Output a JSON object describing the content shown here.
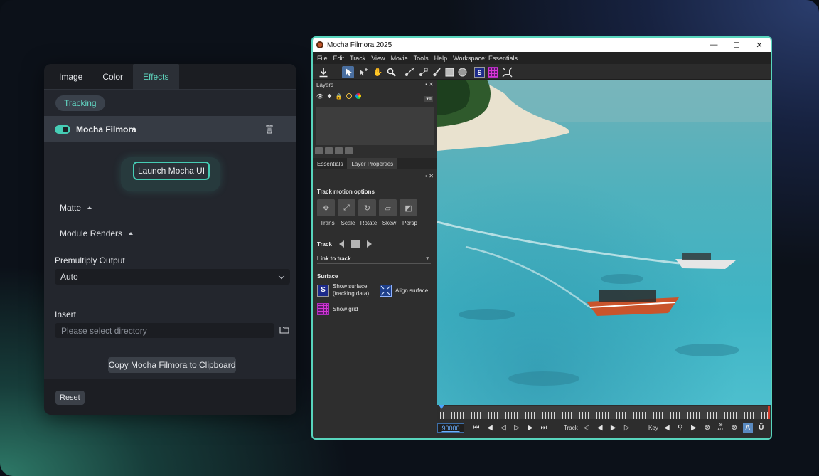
{
  "panel": {
    "tabs": [
      "Image",
      "Color",
      "Effects"
    ],
    "active_tab": "Effects",
    "chip": "Tracking",
    "effect_name": "Mocha Filmora",
    "launch_label": "Launch Mocha UI",
    "matte_label": "Matte",
    "module_renders_label": "Module Renders",
    "premultiply_label": "Premultiply Output",
    "premultiply_value": "Auto",
    "insert_label": "Insert",
    "directory_placeholder": "Please select directory",
    "copy_label": "Copy Mocha Filmora to Clipboard",
    "reset_label": "Reset",
    "accent_color": "#46cdb5"
  },
  "mocha": {
    "title": "Mocha Filmora 2025",
    "window_controls": [
      "—",
      "☐",
      "✕"
    ],
    "menu": [
      "File",
      "Edit",
      "Track",
      "View",
      "Movie",
      "Tools",
      "Help",
      "Workspace: Essentials"
    ],
    "layers_title": "Layers",
    "dock_tabs": [
      "Essentials",
      "Layer Properties"
    ],
    "track_motion_title": "Track motion options",
    "motion_options": [
      "Trans",
      "Scale",
      "Rotate",
      "Skew",
      "Persp"
    ],
    "track_label": "Track",
    "link_to_track": "Link to track",
    "surface_title": "Surface",
    "show_surface": "Show surface",
    "tracking_data": "(tracking data)",
    "align_surface": "Align surface",
    "show_grid": "Show grid",
    "frame_value": "90000",
    "timeline_track_label": "Track",
    "timeline_key_label": "Key",
    "all_label": "ALL",
    "accent_color": "#58d5bd"
  }
}
